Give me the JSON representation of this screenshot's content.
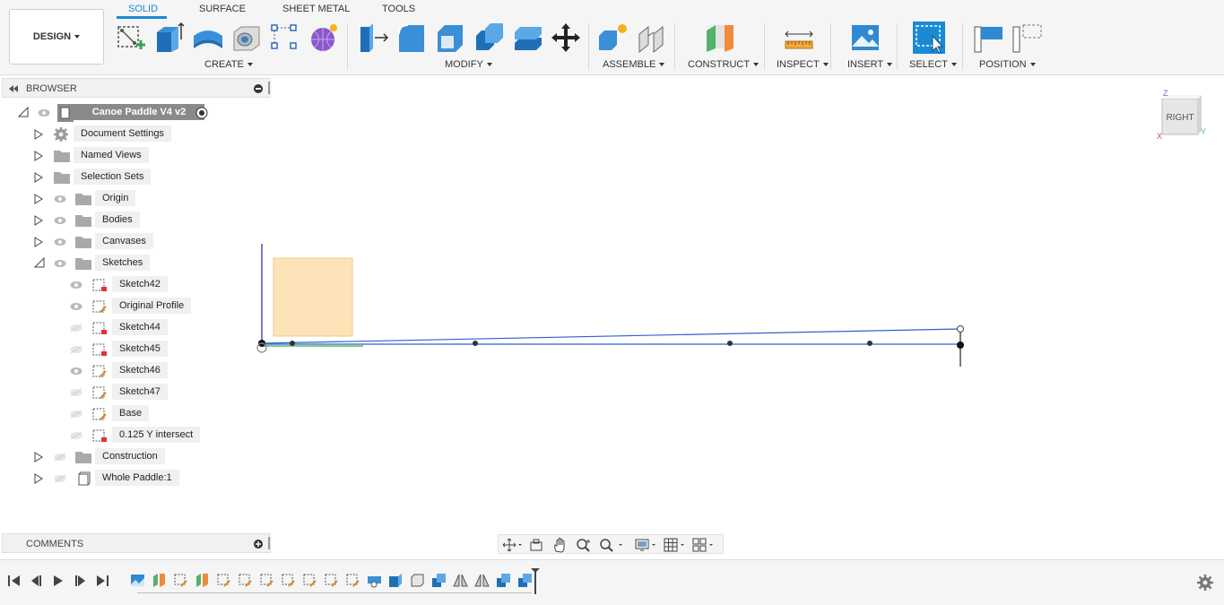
{
  "workspace": {
    "label": "DESIGN"
  },
  "tabs": [
    {
      "label": "SOLID",
      "active": true
    },
    {
      "label": "SURFACE",
      "active": false
    },
    {
      "label": "SHEET METAL",
      "active": false
    },
    {
      "label": "TOOLS",
      "active": false
    }
  ],
  "groups": {
    "create": "CREATE",
    "modify": "MODIFY",
    "assemble": "ASSEMBLE",
    "construct": "CONSTRUCT",
    "inspect": "INSPECT",
    "insert": "INSERT",
    "select": "SELECT",
    "position": "POSITION"
  },
  "browser": {
    "title": "BROWSER",
    "root": "Canoe Paddle V4 v2",
    "items": [
      {
        "label": "Document Settings",
        "icon": "gear-icon"
      },
      {
        "label": "Named Views",
        "icon": "folder-icon"
      },
      {
        "label": "Selection Sets",
        "icon": "folder-icon"
      },
      {
        "label": "Origin",
        "icon": "folder-icon"
      },
      {
        "label": "Bodies",
        "icon": "folder-icon"
      },
      {
        "label": "Canvases",
        "icon": "folder-icon"
      },
      {
        "label": "Sketches",
        "icon": "folder-icon",
        "expanded": true
      },
      {
        "label": "Construction",
        "icon": "folder-icon"
      },
      {
        "label": "Whole Paddle:1",
        "icon": "component-icon"
      }
    ],
    "sketches": [
      {
        "label": "Sketch42",
        "visible": true
      },
      {
        "label": "Original Profile",
        "visible": true
      },
      {
        "label": "Sketch44",
        "visible": false
      },
      {
        "label": "Sketch45",
        "visible": false
      },
      {
        "label": "Sketch46",
        "visible": true
      },
      {
        "label": "Sketch47",
        "visible": false
      },
      {
        "label": "Base",
        "visible": false
      },
      {
        "label": "0.125 Y intersect",
        "visible": false
      }
    ]
  },
  "comments": {
    "title": "COMMENTS"
  },
  "viewcube": {
    "face": "RIGHT",
    "axis_z": "Z",
    "axis_y": "Y",
    "axis_x": "X"
  },
  "colors": {
    "accent": "#1a8ad4",
    "sketch_line": "#2f5fd0",
    "canvas_fill": "#fde3b8"
  }
}
